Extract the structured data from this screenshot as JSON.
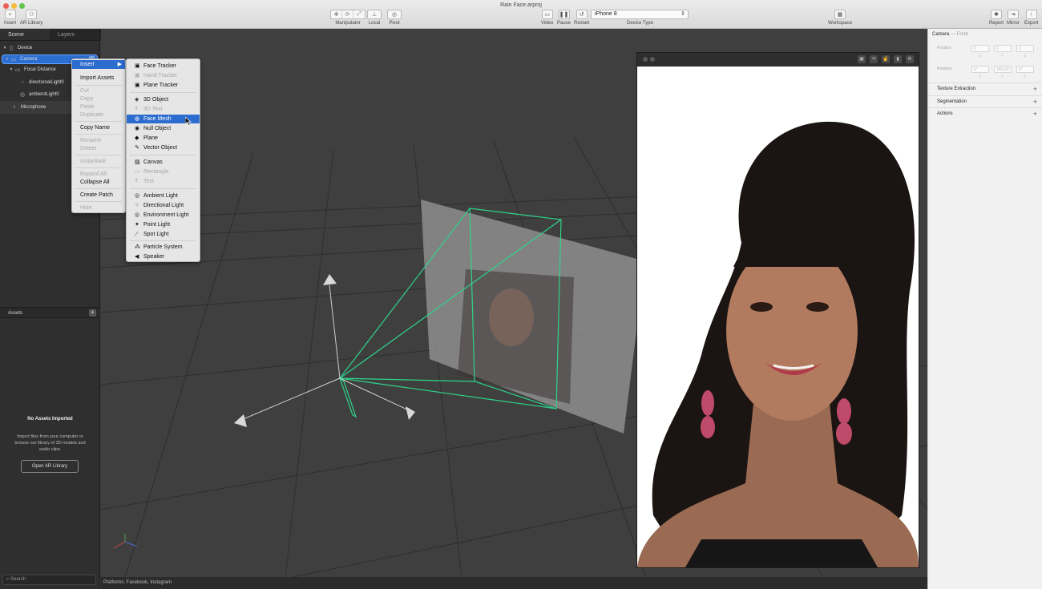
{
  "window": {
    "title": "Rain Face.arproj"
  },
  "toolbar": {
    "insert_label": "Insert",
    "ar_library_label": "AR Library",
    "manipulator_label": "Manipulator",
    "local_label": "Local",
    "pivot_label": "Pivot",
    "video_label": "Video",
    "pause_label": "Pause",
    "restart_label": "Restart",
    "device_type_label": "Device Type",
    "device_selected": "iPhone 8",
    "workspace_label": "Workspace",
    "report_label": "Report",
    "mirror_label": "Mirror",
    "export_label": "Export"
  },
  "left_panel": {
    "tabs": [
      "Scene",
      "Layers"
    ],
    "tree": [
      {
        "label": "Device",
        "icon": "device-icon"
      },
      {
        "label": "Camera",
        "icon": "camera-icon"
      },
      {
        "label": "Focal Distance",
        "icon": "focal-distance-icon"
      },
      {
        "label": "directionalLight0",
        "icon": "directional-light-icon"
      },
      {
        "label": "ambientLight0",
        "icon": "ambient-light-icon"
      },
      {
        "label": "Microphone",
        "icon": "microphone-icon"
      }
    ],
    "assets_header": "Assets",
    "no_assets_title": "No Assets Imported",
    "no_assets_desc": "Import files from your computer or browse our library of 3D models and audio clips.",
    "open_library_label": "Open AR Library",
    "search_placeholder": "Search"
  },
  "context_menu": {
    "items": [
      {
        "label": "Insert",
        "state": "highlighted"
      },
      {
        "label": "Import Assets",
        "state": "enabled"
      },
      {
        "label": "Cut",
        "state": "disabled"
      },
      {
        "label": "Copy",
        "state": "disabled"
      },
      {
        "label": "Paste",
        "state": "disabled"
      },
      {
        "label": "Duplicate",
        "state": "disabled"
      },
      {
        "label": "Copy Name",
        "state": "enabled"
      },
      {
        "label": "Rename",
        "state": "disabled"
      },
      {
        "label": "Delete",
        "state": "disabled"
      },
      {
        "label": "Instantiate",
        "state": "disabled"
      },
      {
        "label": "Expand All",
        "state": "disabled"
      },
      {
        "label": "Collapse All",
        "state": "enabled"
      },
      {
        "label": "Create Patch",
        "state": "enabled"
      },
      {
        "label": "Hide",
        "state": "disabled"
      }
    ]
  },
  "insert_submenu": {
    "items": [
      {
        "label": "Face Tracker",
        "state": "enabled"
      },
      {
        "label": "Hand Tracker",
        "state": "disabled"
      },
      {
        "label": "Plane Tracker",
        "state": "enabled"
      },
      {
        "label": "3D Object",
        "state": "enabled"
      },
      {
        "label": "3D Text",
        "state": "disabled"
      },
      {
        "label": "Face Mesh",
        "state": "highlighted"
      },
      {
        "label": "Null Object",
        "state": "enabled"
      },
      {
        "label": "Plane",
        "state": "enabled"
      },
      {
        "label": "Vector Object",
        "state": "enabled"
      },
      {
        "label": "Canvas",
        "state": "enabled"
      },
      {
        "label": "Rectangle",
        "state": "disabled"
      },
      {
        "label": "Text",
        "state": "disabled"
      },
      {
        "label": "Ambient Light",
        "state": "enabled"
      },
      {
        "label": "Directional Light",
        "state": "enabled"
      },
      {
        "label": "Environment Light",
        "state": "enabled"
      },
      {
        "label": "Point Light",
        "state": "enabled"
      },
      {
        "label": "Spot Light",
        "state": "enabled"
      },
      {
        "label": "Particle System",
        "state": "enabled"
      },
      {
        "label": "Speaker",
        "state": "enabled"
      }
    ]
  },
  "inspector": {
    "title": "Camera",
    "subtitle": "— Front",
    "position_label": "Position",
    "rotation_label": "Rotation",
    "position_values": [
      "0",
      "0",
      "0"
    ],
    "rotation_values": [
      "0°",
      "180.00°",
      "0°"
    ],
    "axis_labels": [
      "X",
      "Y",
      "Z"
    ],
    "sections": [
      "Texture Extraction",
      "Segmentation",
      "Actions"
    ]
  },
  "status_bar": {
    "text": "Platforms: Facebook, Instagram"
  },
  "colors": {
    "selection": "#2b6fd3",
    "camera_frustum": "#2fd48a",
    "menu_highlight": "#2d6ccf"
  }
}
